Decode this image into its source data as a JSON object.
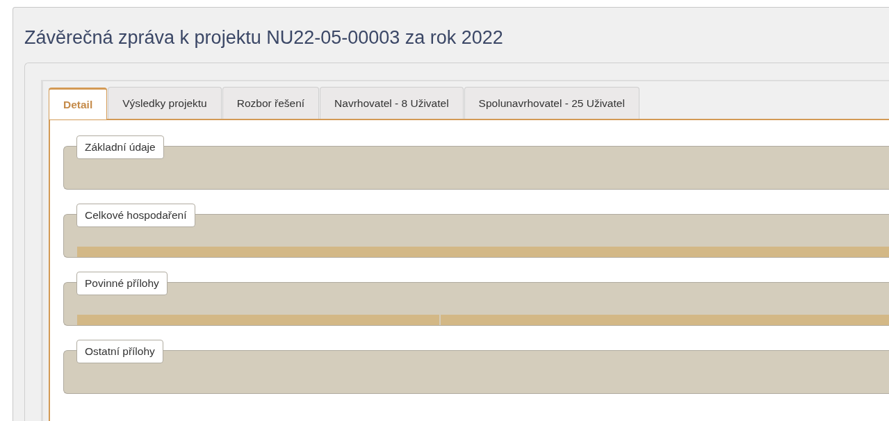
{
  "window": {
    "title": "Závěrečná zpráva k projektu NU22-05-00003 za rok 2022"
  },
  "tabs": [
    {
      "label": "Detail",
      "selected": true
    },
    {
      "label": "Výsledky projektu",
      "selected": false
    },
    {
      "label": "Rozbor řešení",
      "selected": false
    },
    {
      "label": "Navrhovatel - 8 Uživatel",
      "selected": false
    },
    {
      "label": "Spolunavrhovatel - 25 Uživatel",
      "selected": false
    }
  ],
  "sections": [
    {
      "legend": "Základní údaje",
      "kind": "plain"
    },
    {
      "legend": "Celkové hospodaření",
      "kind": "table"
    },
    {
      "legend": "Povinné přílohy",
      "kind": "split-table"
    },
    {
      "legend": "Ostatní přílohy",
      "kind": "plain"
    }
  ]
}
